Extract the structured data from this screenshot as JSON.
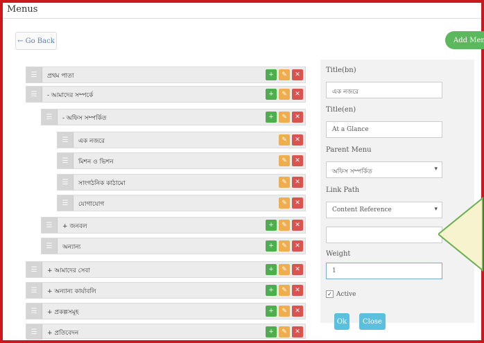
{
  "page": {
    "title": "Menus"
  },
  "toolbar": {
    "go_back_label": "Go Back",
    "go_back_icon": "arrow-left-icon",
    "add_menu_label": "Add Menu"
  },
  "menu_tree": [
    {
      "label": "প্রথম পাতা",
      "prefix": "",
      "actions": [
        "add",
        "edit",
        "delete"
      ]
    },
    {
      "label": "আমাদের সম্পর্কে",
      "prefix": "-",
      "actions": [
        "add",
        "edit",
        "delete"
      ]
    },
    {
      "label": "অফিস সম্পর্কিত",
      "prefix": "-",
      "actions": [
        "add",
        "edit",
        "delete"
      ]
    },
    {
      "label": "এক নজরে",
      "prefix": "",
      "actions": [
        "edit",
        "delete"
      ]
    },
    {
      "label": "মিশন ও ভিশন",
      "prefix": "",
      "actions": [
        "edit",
        "delete"
      ]
    },
    {
      "label": "সাংগঠনিক কাঠামো",
      "prefix": "",
      "actions": [
        "edit",
        "delete"
      ]
    },
    {
      "label": "যোগাযোগ",
      "prefix": "",
      "actions": [
        "edit",
        "delete"
      ]
    },
    {
      "label": "জনবল",
      "prefix": "+",
      "actions": [
        "add",
        "edit",
        "delete"
      ]
    },
    {
      "label": "অন্যান্য",
      "prefix": "",
      "actions": [
        "add",
        "edit",
        "delete"
      ]
    },
    {
      "label": "আমাদের সেবা",
      "prefix": "+",
      "actions": [
        "add",
        "edit",
        "delete"
      ]
    },
    {
      "label": "অন্যান্য কার্যাবলি",
      "prefix": "+",
      "actions": [
        "add",
        "edit",
        "delete"
      ]
    },
    {
      "label": "প্রকল্পসমূহ",
      "prefix": "+",
      "actions": [
        "add",
        "edit",
        "delete"
      ]
    },
    {
      "label": "প্রতিবেদন",
      "prefix": "+",
      "actions": [
        "add",
        "edit",
        "delete"
      ]
    }
  ],
  "form": {
    "title_bn_label": "Title(bn)",
    "title_bn_value": "এক নজরে",
    "title_en_label": "Title(en)",
    "title_en_value": "At a Glance",
    "parent_menu_label": "Parent Menu",
    "parent_menu_value": "অফিস সম্পর্কিত",
    "link_path_label": "Link Path",
    "link_path_value": "Content Reference",
    "extra_value": "",
    "weight_label": "Weight",
    "weight_value": "1",
    "active_label": "Active",
    "active_checked": true,
    "ok_label": "Ok",
    "close_label": "Close"
  },
  "colors": {
    "frame": "#c9181e",
    "add": "#4cae4c",
    "edit": "#f0ad4e",
    "delete": "#d9534f",
    "info": "#5bc0de",
    "callout": "#f7f3cf"
  }
}
